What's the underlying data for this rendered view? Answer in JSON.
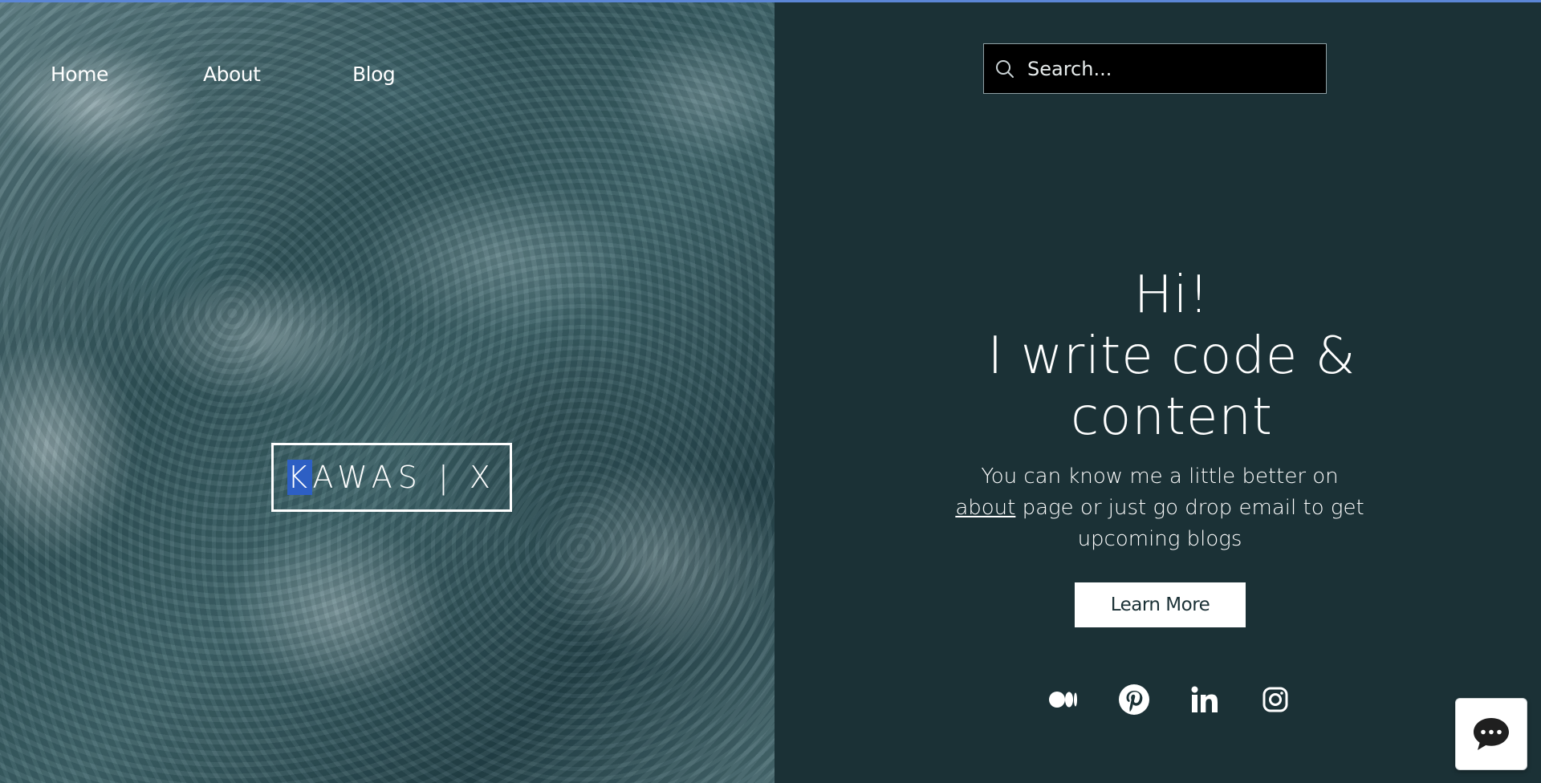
{
  "nav": {
    "items": [
      {
        "label": "Home"
      },
      {
        "label": "About"
      },
      {
        "label": "Blog"
      }
    ]
  },
  "logo": {
    "first_letter": "K",
    "rest": "AWAS | X"
  },
  "search": {
    "placeholder": "Search..."
  },
  "hero": {
    "line1": "Hi!",
    "line2": "I write code &",
    "line3": "content",
    "text_before": "You can know me a little better on",
    "link": "about",
    "text_after": "page or just go drop email to get upcoming blogs",
    "button_label": "Learn More"
  },
  "social": [
    "medium-icon",
    "pinterest-icon",
    "linkedin-icon",
    "instagram-icon"
  ],
  "colors": {
    "background": "#1b3136",
    "accent_selection": "#2d5fc4",
    "top_line": "#5b86d6"
  }
}
